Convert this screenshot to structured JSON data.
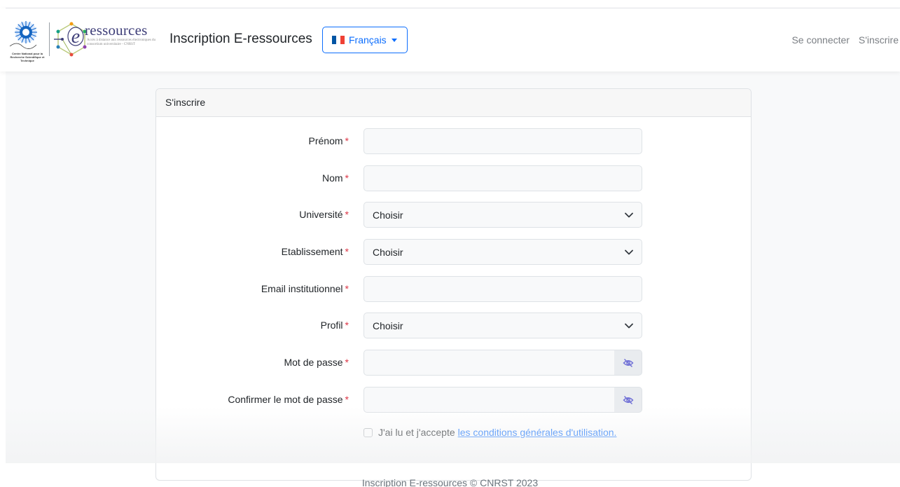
{
  "header": {
    "brand_title": "Inscription E-ressources",
    "logo_word": "ressources",
    "logo_tagline": "Accès à distance aux ressources électroniques du consortium universitaire - CNRST",
    "cnrst_caption": "Centre National pour la Recherche Scientifique et Technique",
    "language": {
      "label": "Français",
      "flag_colors": [
        "#0055a4",
        "#ffffff",
        "#ef4135"
      ]
    },
    "links": {
      "login": "Se connecter",
      "register": "S'inscrire"
    }
  },
  "form": {
    "card_title": "S'inscrire",
    "required_mark": "*",
    "fields": {
      "first_name": {
        "label": "Prénom",
        "value": ""
      },
      "last_name": {
        "label": "Nom",
        "value": ""
      },
      "university": {
        "label": "Université",
        "selected": "Choisir"
      },
      "establishment": {
        "label": "Etablissement",
        "selected": "Choisir"
      },
      "email": {
        "label": "Email institutionnel",
        "value": ""
      },
      "profile": {
        "label": "Profil",
        "selected": "Choisir"
      },
      "password": {
        "label": "Mot de passe",
        "value": ""
      },
      "confirm_password": {
        "label": "Confirmer le mot de passe",
        "value": ""
      }
    },
    "terms": {
      "text": "J'ai lu et j'accepte",
      "link": "les conditions générales d'utilisation.",
      "checked": false
    }
  },
  "footer": {
    "text": "Inscription E-ressources © CNRST 2023"
  },
  "colors": {
    "primary": "#0d6efd",
    "required": "#dc3545",
    "logo_word": "#3f3f79"
  }
}
